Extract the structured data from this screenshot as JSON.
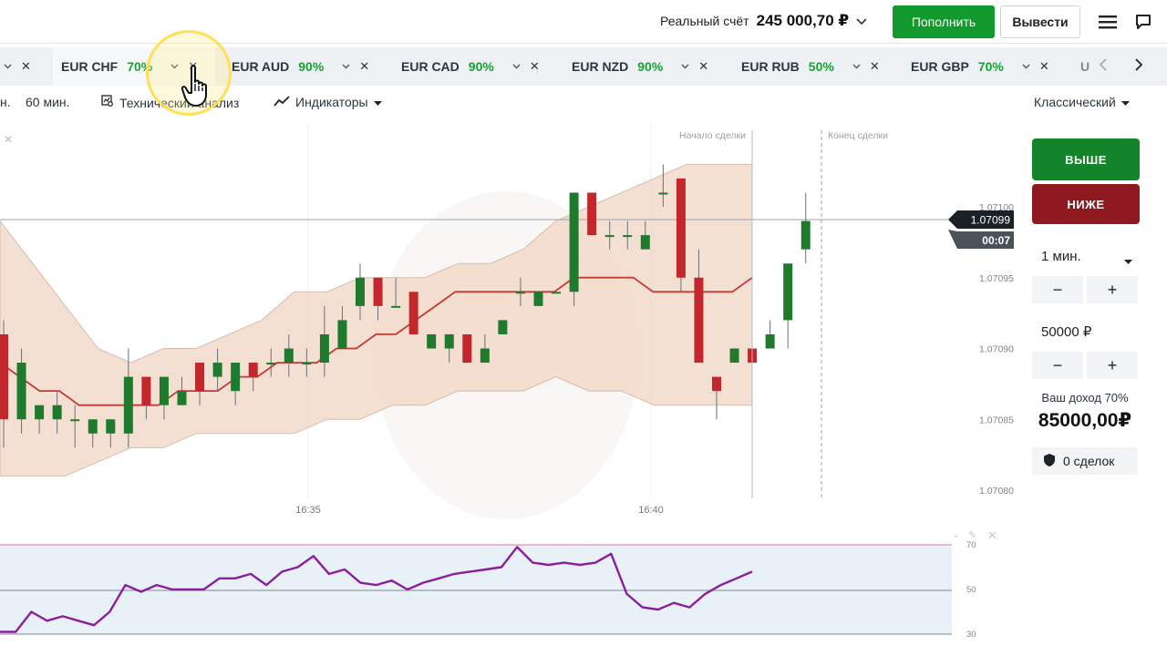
{
  "header": {
    "account_label": "Реальный счёт",
    "account_balance": "245 000,70 ₽",
    "deposit_label": "Пополнить",
    "withdraw_label": "Вывести",
    "icons": [
      "chevron-down-icon",
      "menu-icon",
      "chat-icon"
    ]
  },
  "tabs": [
    {
      "name": "EUR CHF",
      "pct": "70%",
      "active": true
    },
    {
      "name": "EUR AUD",
      "pct": "90%"
    },
    {
      "name": "EUR CAD",
      "pct": "90%"
    },
    {
      "name": "EUR NZD",
      "pct": "90%"
    },
    {
      "name": "EUR RUB",
      "pct": "50%"
    },
    {
      "name": "EUR GBP",
      "pct": "70%"
    },
    {
      "name": "U",
      "pct": ""
    }
  ],
  "toolbar": {
    "timeframe_partial": "н.",
    "timeframe": "60 мин.",
    "tech_analysis": "Технический анализ",
    "indicators": "Индикаторы",
    "view_mode": "Классический"
  },
  "chart": {
    "trade_start_label": "Начало сделки",
    "trade_end_label": "Конец сделки",
    "current_price": "1.07099",
    "countdown": "00:07",
    "y_ticks": [
      "1.07100",
      "1.07095",
      "1.07090",
      "1.07085",
      "1.07080"
    ],
    "x_ticks": [
      "16:35",
      "16:40"
    ],
    "rsi_ticks": [
      "70",
      "50",
      "30"
    ],
    "colors": {
      "up": "#1e7a2c",
      "down": "#c3262b",
      "band_fill": "#f1d6c3",
      "ma": "#c33a35",
      "rsi": "#8a1f9c"
    }
  },
  "chart_data": {
    "type": "candlestick",
    "series_name": "EUR CHF",
    "ylim": [
      1.07077,
      1.07112
    ],
    "y_ticks": [
      1.071,
      1.07095,
      1.0709,
      1.07085,
      1.0708
    ],
    "x_ticks": [
      "16:35",
      "16:40"
    ],
    "candles": [
      {
        "o": 1.07091,
        "h": 1.07092,
        "c": 1.07085,
        "l": 1.07083
      },
      {
        "o": 1.07085,
        "h": 1.0709,
        "c": 1.07089,
        "l": 1.07084
      },
      {
        "o": 1.07085,
        "h": 1.07086,
        "c": 1.07086,
        "l": 1.07084
      },
      {
        "o": 1.07085,
        "h": 1.07087,
        "c": 1.07086,
        "l": 1.07084
      },
      {
        "o": 1.07085,
        "h": 1.07086,
        "c": 1.07085,
        "l": 1.07083
      },
      {
        "o": 1.07084,
        "h": 1.07085,
        "c": 1.07085,
        "l": 1.07083
      },
      {
        "o": 1.07084,
        "h": 1.07085,
        "c": 1.07085,
        "l": 1.07083
      },
      {
        "o": 1.07084,
        "h": 1.0709,
        "c": 1.07088,
        "l": 1.07083
      },
      {
        "o": 1.07088,
        "h": 1.07088,
        "c": 1.07086,
        "l": 1.07085
      },
      {
        "o": 1.07086,
        "h": 1.07088,
        "c": 1.07088,
        "l": 1.07085
      },
      {
        "o": 1.07086,
        "h": 1.07088,
        "c": 1.07087,
        "l": 1.07086
      },
      {
        "o": 1.07089,
        "h": 1.07089,
        "c": 1.07087,
        "l": 1.07086
      },
      {
        "o": 1.07088,
        "h": 1.0709,
        "c": 1.07089,
        "l": 1.07087
      },
      {
        "o": 1.07087,
        "h": 1.07089,
        "c": 1.07089,
        "l": 1.07086
      },
      {
        "o": 1.07089,
        "h": 1.07089,
        "c": 1.07088,
        "l": 1.07087
      },
      {
        "o": 1.07089,
        "h": 1.0709,
        "c": 1.07089,
        "l": 1.07088
      },
      {
        "o": 1.07089,
        "h": 1.07091,
        "c": 1.0709,
        "l": 1.07088
      },
      {
        "o": 1.07089,
        "h": 1.0709,
        "c": 1.07089,
        "l": 1.07088
      },
      {
        "o": 1.07089,
        "h": 1.07093,
        "c": 1.07091,
        "l": 1.07088
      },
      {
        "o": 1.0709,
        "h": 1.07093,
        "c": 1.07092,
        "l": 1.0709
      },
      {
        "o": 1.07093,
        "h": 1.07096,
        "c": 1.07095,
        "l": 1.07092
      },
      {
        "o": 1.07095,
        "h": 1.07095,
        "c": 1.07093,
        "l": 1.07092
      },
      {
        "o": 1.07093,
        "h": 1.07095,
        "c": 1.07093,
        "l": 1.07093
      },
      {
        "o": 1.07094,
        "h": 1.07094,
        "c": 1.07091,
        "l": 1.07091
      },
      {
        "o": 1.0709,
        "h": 1.07091,
        "c": 1.07091,
        "l": 1.0709
      },
      {
        "o": 1.0709,
        "h": 1.07091,
        "c": 1.07091,
        "l": 1.07089
      },
      {
        "o": 1.07091,
        "h": 1.07091,
        "c": 1.07089,
        "l": 1.07089
      },
      {
        "o": 1.07089,
        "h": 1.07091,
        "c": 1.0709,
        "l": 1.07089
      },
      {
        "o": 1.07091,
        "h": 1.07092,
        "c": 1.07092,
        "l": 1.07091
      },
      {
        "o": 1.07094,
        "h": 1.07095,
        "c": 1.07094,
        "l": 1.07093
      },
      {
        "o": 1.07093,
        "h": 1.07094,
        "c": 1.07094,
        "l": 1.07093
      },
      {
        "o": 1.07094,
        "h": 1.07094,
        "c": 1.07094,
        "l": 1.07094
      },
      {
        "o": 1.07094,
        "h": 1.07101,
        "c": 1.07101,
        "l": 1.07093
      },
      {
        "o": 1.07101,
        "h": 1.07101,
        "c": 1.07098,
        "l": 1.07098
      },
      {
        "o": 1.07098,
        "h": 1.07099,
        "c": 1.07098,
        "l": 1.07097
      },
      {
        "o": 1.07098,
        "h": 1.07099,
        "c": 1.07098,
        "l": 1.07097
      },
      {
        "o": 1.07097,
        "h": 1.07099,
        "c": 1.07098,
        "l": 1.07097
      },
      {
        "o": 1.07101,
        "h": 1.07103,
        "c": 1.07101,
        "l": 1.071
      },
      {
        "o": 1.07102,
        "h": 1.07102,
        "c": 1.07095,
        "l": 1.07094
      },
      {
        "o": 1.07095,
        "h": 1.07097,
        "c": 1.07089,
        "l": 1.07089
      },
      {
        "o": 1.07088,
        "h": 1.07088,
        "c": 1.07087,
        "l": 1.07085
      },
      {
        "o": 1.07089,
        "h": 1.0709,
        "c": 1.0709,
        "l": 1.07089
      },
      {
        "o": 1.0709,
        "h": 1.0709,
        "c": 1.07089,
        "l": 1.07089
      },
      {
        "o": 1.0709,
        "h": 1.07092,
        "c": 1.07091,
        "l": 1.0709
      },
      {
        "o": 1.07092,
        "h": 1.07095,
        "c": 1.07096,
        "l": 1.0709
      },
      {
        "o": 1.07097,
        "h": 1.07101,
        "c": 1.07099,
        "l": 1.07096
      }
    ],
    "ma": [
      1.07089,
      1.07088,
      1.07087,
      1.07087,
      1.07086,
      1.07086,
      1.07086,
      1.07086,
      1.07086,
      1.07087,
      1.07087,
      1.07087,
      1.07088,
      1.07088,
      1.07089,
      1.07089,
      1.07089,
      1.0709,
      1.0709,
      1.07091,
      1.07091,
      1.07092,
      1.07093,
      1.07094,
      1.07094,
      1.07094,
      1.07094,
      1.07094,
      1.07094,
      1.07095,
      1.07095,
      1.07095,
      1.07095,
      1.07094,
      1.07094,
      1.07094,
      1.07094,
      1.07094,
      1.07095
    ],
    "band_upper": [
      1.07099,
      1.07096,
      1.07093,
      1.0709,
      1.07089,
      1.0709,
      1.0709,
      1.07091,
      1.07092,
      1.07094,
      1.07094,
      1.07095,
      1.07095,
      1.07095,
      1.07096,
      1.07096,
      1.07097,
      1.07099,
      1.071,
      1.07101,
      1.07102,
      1.07103,
      1.07103,
      1.07103
    ],
    "band_lower": [
      1.07081,
      1.07081,
      1.07081,
      1.07082,
      1.07083,
      1.07083,
      1.07084,
      1.07084,
      1.07084,
      1.07084,
      1.07085,
      1.07085,
      1.07086,
      1.07086,
      1.07087,
      1.07087,
      1.07087,
      1.07088,
      1.07087,
      1.07087,
      1.07086,
      1.07086,
      1.07086,
      1.07086
    ],
    "rsi": {
      "ylim": [
        30,
        70
      ],
      "ticks": [
        70,
        50,
        30
      ],
      "values": [
        31,
        31,
        40,
        36,
        38,
        36,
        34,
        40,
        52,
        49,
        52,
        50,
        50,
        50,
        55,
        55,
        57,
        52,
        58,
        60,
        65,
        57,
        59,
        53,
        52,
        54,
        50,
        53,
        55,
        57,
        58,
        59,
        60,
        69,
        62,
        61,
        62,
        61,
        62,
        66,
        48,
        42,
        41,
        44,
        42,
        48,
        52,
        55,
        58
      ]
    }
  },
  "trade_panel": {
    "up_label": "ВЫШЕ",
    "down_label": "НИЖЕ",
    "duration": "1 мин.",
    "amount": "50000 ₽",
    "income_label": "Ваш доход 70%",
    "income_value": "85000,00₽",
    "deals_label": "0 сделок",
    "minus": "−",
    "plus": "+"
  }
}
